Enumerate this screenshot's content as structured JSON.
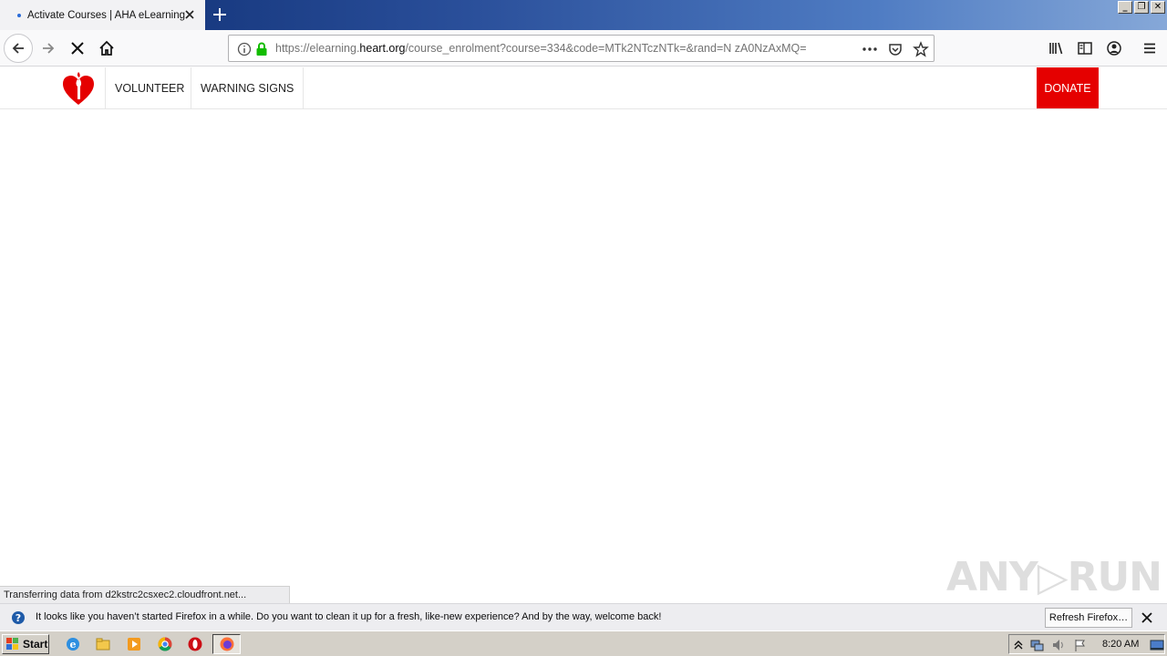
{
  "browser": {
    "tab_title": "Activate Courses | AHA eLearning",
    "url_prefix": "https://elearning.",
    "url_domain": "heart.org",
    "url_rest": "/course_enrolment?course=334&code=MTk2NTczNTk=&rand=N zA0NzAxMQ=",
    "status_text": "Transferring data from d2kstrc2csxec2.cloudfront.net..."
  },
  "site": {
    "nav": [
      "VOLUNTEER",
      "WARNING SIGNS"
    ],
    "donate_label": "DONATE",
    "brand_color": "#e50000"
  },
  "notification": {
    "message": "It looks like you haven’t started Firefox in a while. Do you want to clean it up for a fresh, like-new experience? And by the way, welcome back!",
    "button_label": "Refresh Firefox…"
  },
  "taskbar": {
    "start_label": "Start",
    "clock": "8:20 AM"
  },
  "watermark": {
    "text": "ANY▷RUN"
  }
}
